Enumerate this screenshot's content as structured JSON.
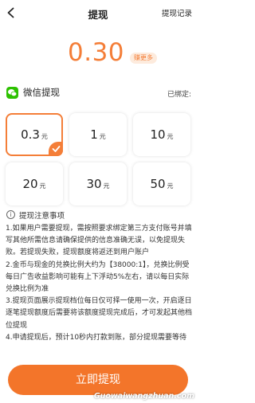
{
  "header": {
    "title": "提现",
    "record_label": "提现记录"
  },
  "balance": {
    "amount": "0.30",
    "earn_more_label": "赚更多"
  },
  "payment": {
    "method_label": "微信提现",
    "bound_label": "已绑定:"
  },
  "options": [
    {
      "value": "0.3",
      "unit": "元",
      "selected": true
    },
    {
      "value": "1",
      "unit": "元",
      "selected": false
    },
    {
      "value": "10",
      "unit": "元",
      "selected": false
    },
    {
      "value": "20",
      "unit": "元",
      "selected": false
    },
    {
      "value": "30",
      "unit": "元",
      "selected": false
    },
    {
      "value": "50",
      "unit": "元",
      "selected": false
    }
  ],
  "notice": {
    "title": "提现注意事项",
    "rules": [
      "1.如果用户需要提现，需按照要求绑定第三方支付账号并填写其他所需信息请确保提供的信息准确无误，以免提现失败。若提现失败，提现额度将返还到用户账户",
      "2.金币与现金的兑换比例大约为【38000:1】，兑换比例受每日广告收益影响可能有上下浮动5%左右，请以每日实际兑换比例为准",
      "3.提现页面展示提现档位每日仅可择一使用一次，开启逐日逐笔提现额度后需要将该额度提现完成后，才可发起其他档位提现",
      "4.申请提现后，预计10秒内打款到账，部分提现需要等待"
    ]
  },
  "withdraw_button_label": "立即提现",
  "watermark": "Guowaiwangzhuan.com",
  "colors": {
    "accent": "#F47E38",
    "wechat": "#2DC100"
  }
}
